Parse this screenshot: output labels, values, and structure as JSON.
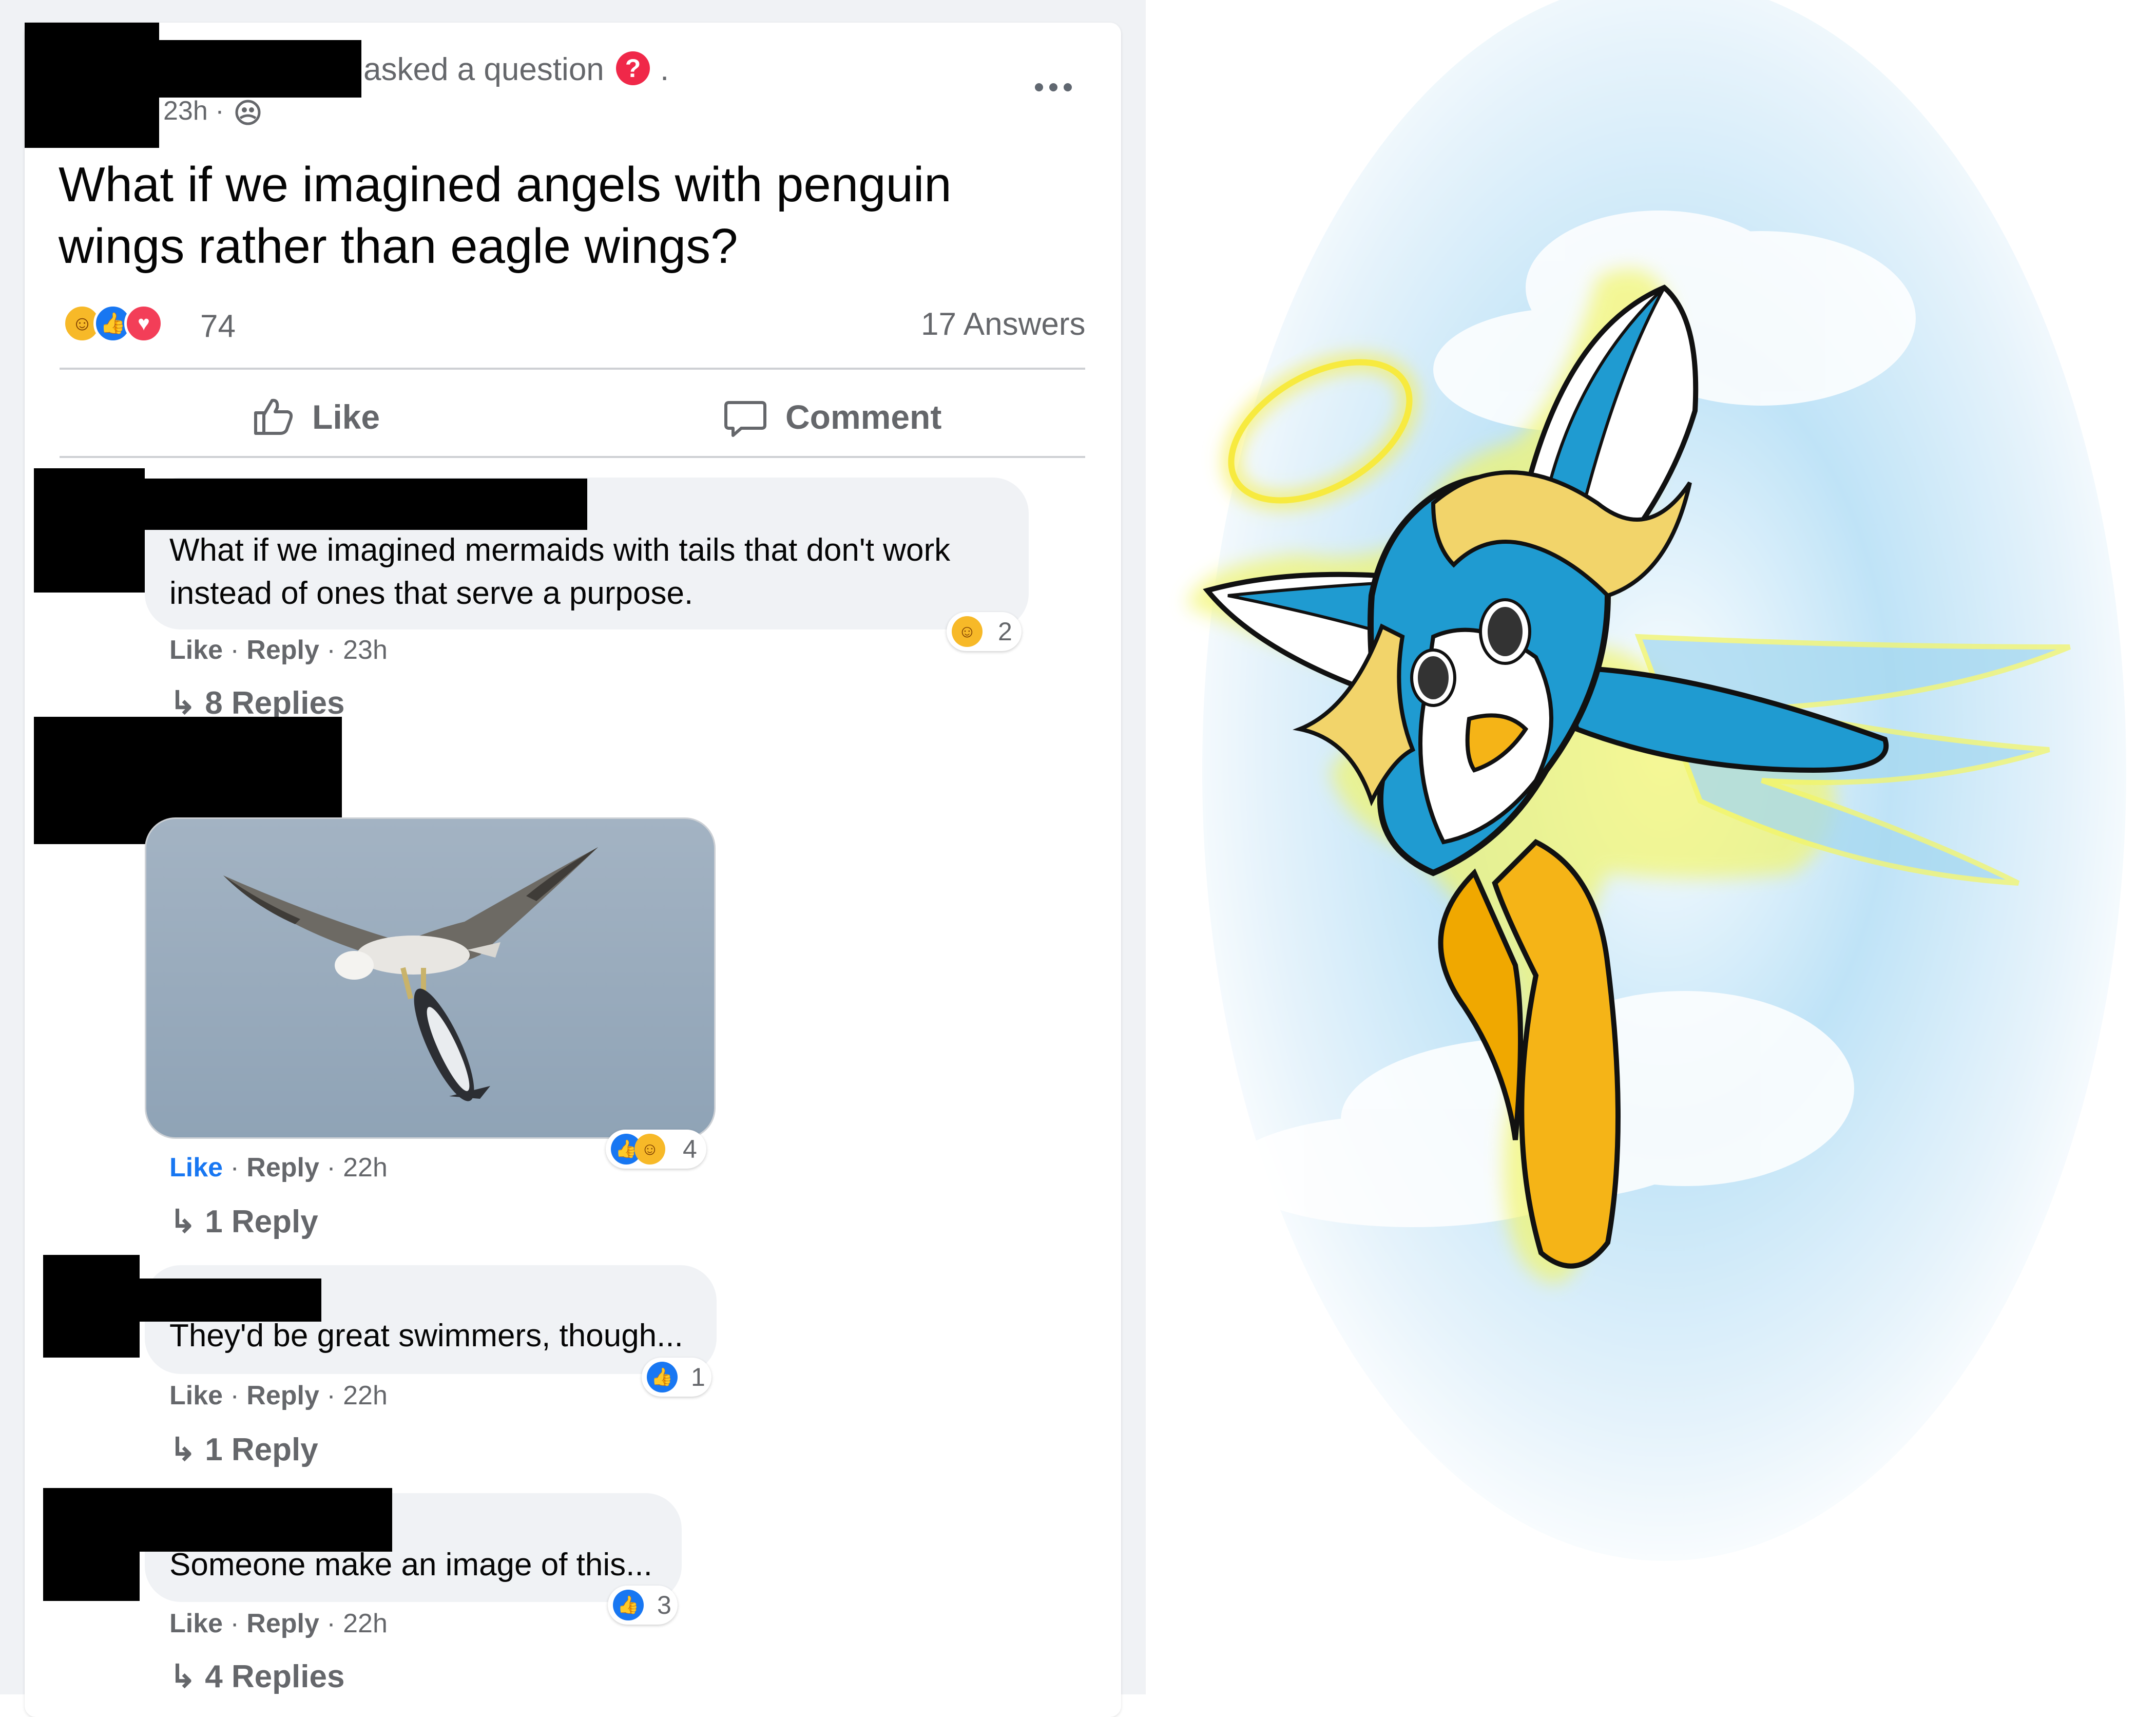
{
  "post": {
    "action_text": "asked a question",
    "question_icon": "question-icon",
    "dot": ".",
    "timestamp": "23h ·",
    "privacy_icon": "friends-icon",
    "more_icon": "more-icon",
    "question": "What if we imagined angels with penguin wings rather than eagle wings?",
    "reaction_icons": [
      "haha-reaction-icon",
      "like-reaction-icon",
      "love-reaction-icon"
    ],
    "reaction_count": "74",
    "answers": "17 Answers"
  },
  "actions": {
    "like_label": "Like",
    "comment_label": "Comment"
  },
  "comments": [
    {
      "text": "What if we imagined mermaids with tails that don't work instead of ones that serve a purpose.",
      "like": "Like",
      "reply": "Reply",
      "time": "23h",
      "reaction_count": "2",
      "reactions": [
        "haha"
      ],
      "replies": "8 Replies"
    },
    {
      "image": "eagle-carrying-penguin-photo",
      "like": "Like",
      "liked": true,
      "reply": "Reply",
      "time": "22h",
      "reaction_count": "4",
      "reactions": [
        "like",
        "haha"
      ],
      "replies": "1 Reply"
    },
    {
      "text": "They'd be great swimmers, though...",
      "like": "Like",
      "reply": "Reply",
      "time": "22h",
      "reaction_count": "1",
      "reactions": [
        "like"
      ],
      "replies": "1 Reply"
    },
    {
      "text": "Someone make an image of this...",
      "like": "Like",
      "reply": "Reply",
      "time": "22h",
      "reaction_count": "3",
      "reactions": [
        "like"
      ],
      "replies": "4 Replies"
    }
  ],
  "illustration": {
    "subject": "angel-penguin-illustration",
    "colors": {
      "body": "#1f9bd1",
      "hair": "#f2d46a",
      "feet": "#f5b417",
      "halo": "#f6ef5a",
      "sky": "#cfe8f8"
    }
  }
}
